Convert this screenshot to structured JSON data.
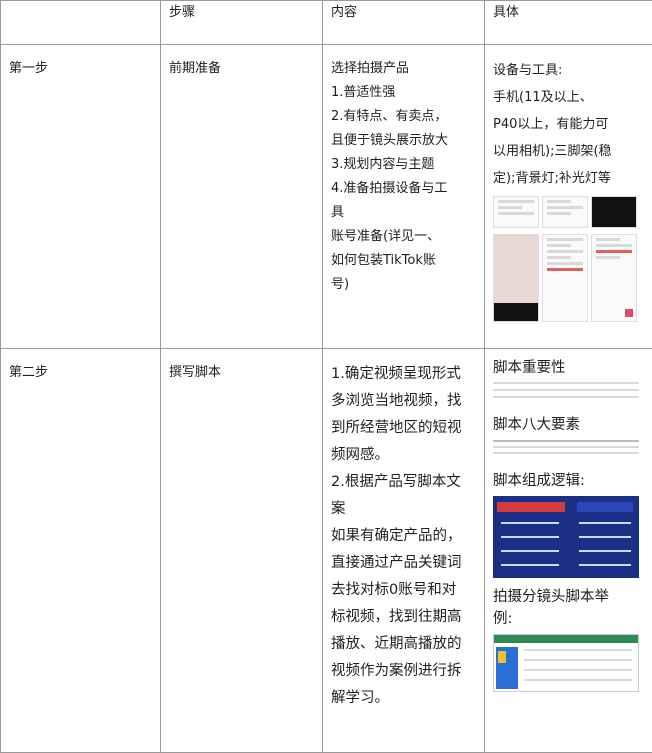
{
  "table": {
    "headers": [
      "",
      "步骤",
      "内容",
      "具体"
    ],
    "rows": [
      {
        "step": "第一步",
        "name": "前期准备",
        "content_lines": [
          "选择拍摄产品",
          "1.普适性强",
          "2.有特点、有卖点，",
          "且便于镜头展示放大",
          "3.规划内容与主题",
          "4.准备拍摄设备与工",
          "具",
          "账号准备(详见一、",
          "如何包装TikTok账",
          "号)"
        ],
        "detail_lines": [
          "设备与工具:",
          "手机(11及以上、",
          "P40以上，有能力可",
          "以用相机);三脚架(稳",
          "定);背景灯;补光灯等"
        ]
      },
      {
        "step": "第二步",
        "name": "撰写脚本",
        "content_lines": [
          "1.确定视频呈现形式",
          "多浏览当地视频，找",
          "到所经营地区的短视",
          "频网感。",
          "2.根据产品写脚本文",
          "案",
          "如果有确定产品的，",
          "直接通过产品关键词",
          "去找对标0账号和对",
          "标视频，找到往期高",
          "播放、近期高播放的",
          "视频作为案例进行拆",
          "解学习。"
        ],
        "detail_headings": [
          "脚本重要性",
          "脚本八大要素",
          "脚本组成逻辑:",
          "拍摄分镜头脚本举",
          "例:"
        ]
      }
    ]
  },
  "colors": {
    "border": "#9a9a9a",
    "figure_blue": "#1b2f86",
    "figure_red": "#d43b3b"
  }
}
